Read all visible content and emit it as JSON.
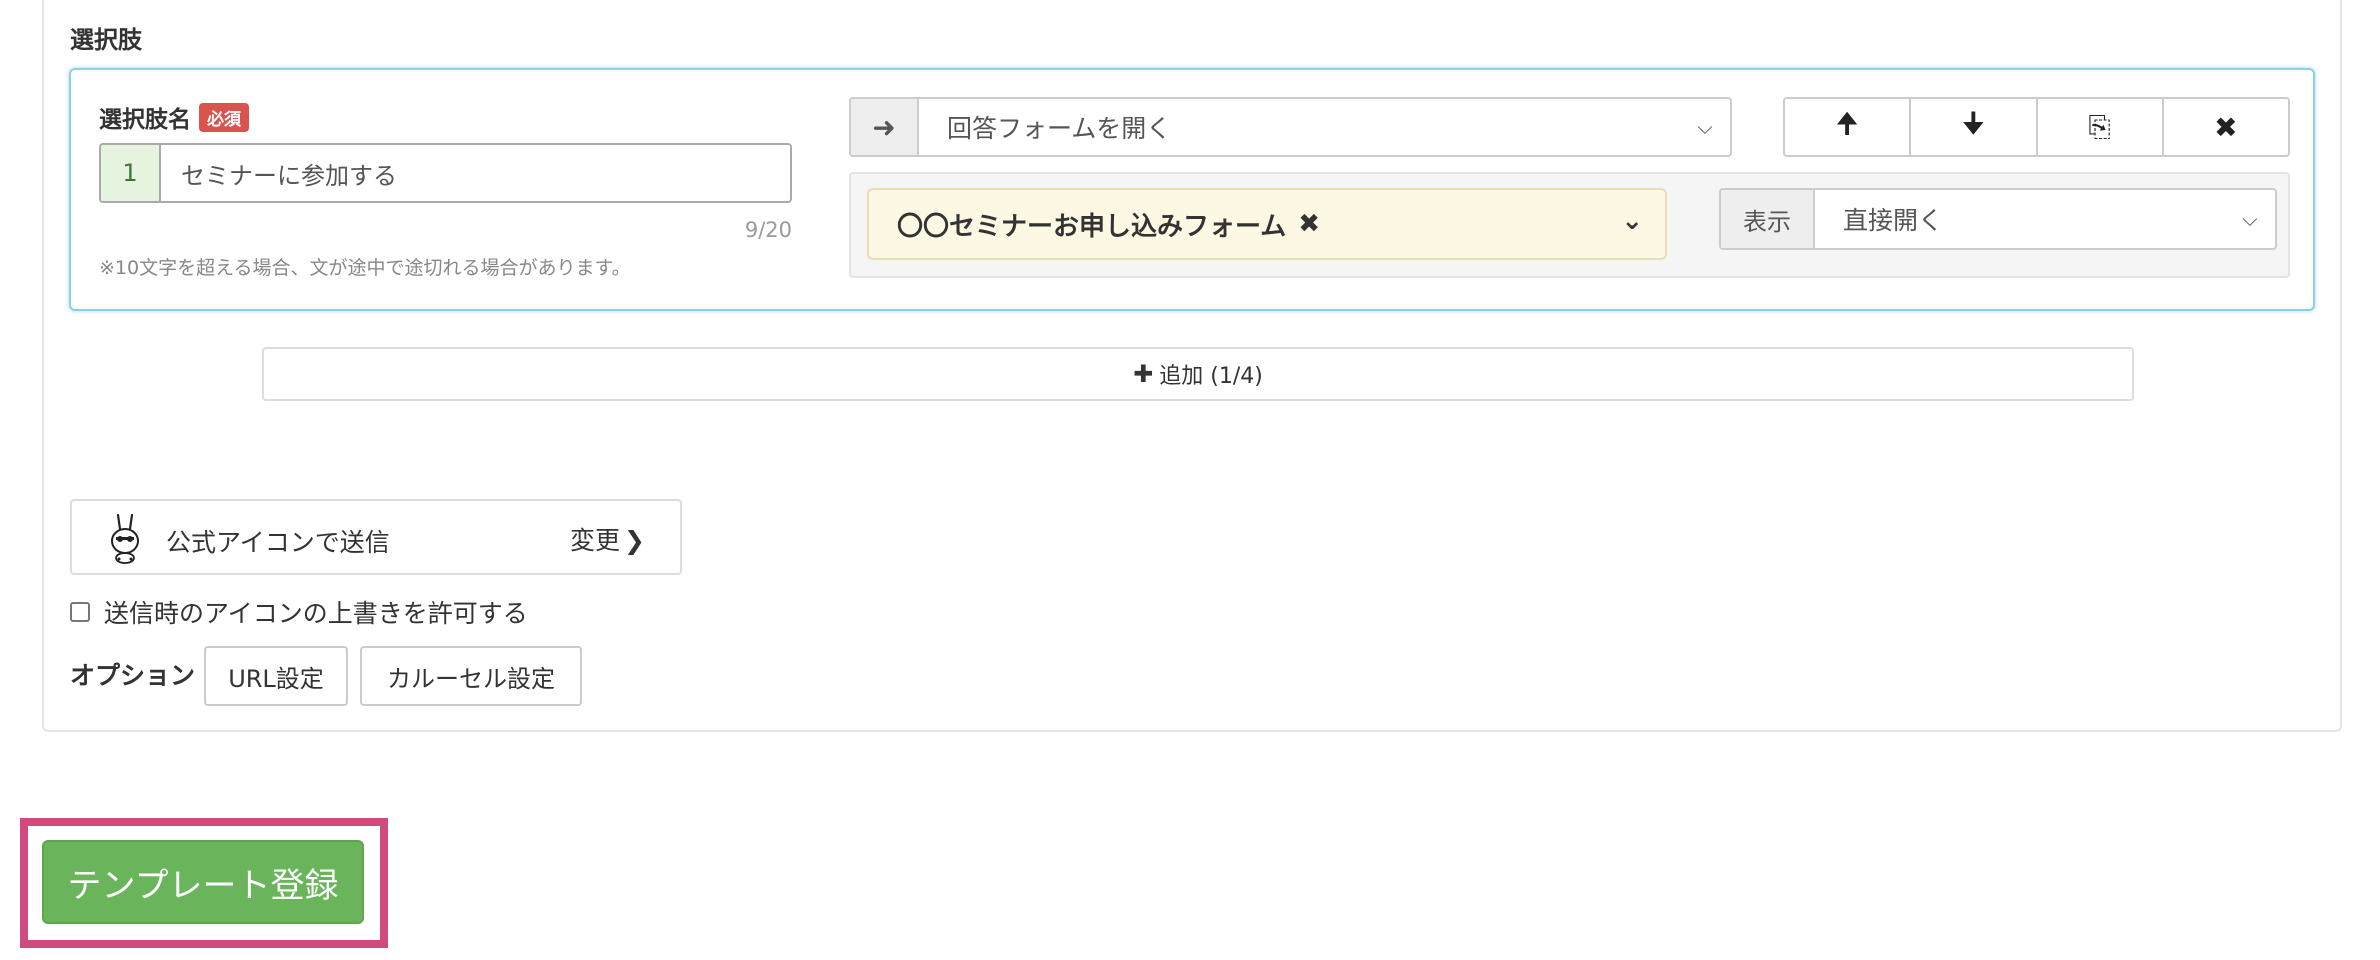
{
  "section": {
    "title": "選択肢"
  },
  "choice": {
    "name_label": "選択肢名",
    "required_badge": "必須",
    "index": "1",
    "name_value": "セミナーに参加する",
    "char_count": "9/20",
    "help_text": "※10文字を超える場合、文が途中で途切れる場合があります。",
    "action_icon": "➜",
    "action_value": "回答フォームを開く",
    "select_caret": "⌵",
    "buttons": {
      "move_up": "🠉",
      "move_down": "🠋",
      "copy": "⎘",
      "delete": "✖"
    },
    "form_tag": {
      "label": "〇〇セミナーお申し込みフォーム",
      "remove": "✖",
      "chevron": "⌄"
    },
    "display": {
      "label": "表示",
      "value": "直接開く"
    }
  },
  "add_button": {
    "plus": "✚",
    "label": "追加 (1/4)"
  },
  "sender": {
    "label": "公式アイコンで送信",
    "change_label": "変更",
    "change_chevron": "❯"
  },
  "override": {
    "label": "送信時のアイコンの上書きを許可する",
    "checked": false
  },
  "options": {
    "label": "オプション",
    "url_button": "URL設定",
    "carousel_button": "カルーセル設定"
  },
  "submit": {
    "label": "テンプレート登録"
  },
  "colors": {
    "accent_border": "#8fcfe3",
    "required": "#d9534f",
    "tag_bg": "#fcf8e3",
    "submit_green": "#6ab55c",
    "highlight": "#d14a7e"
  }
}
